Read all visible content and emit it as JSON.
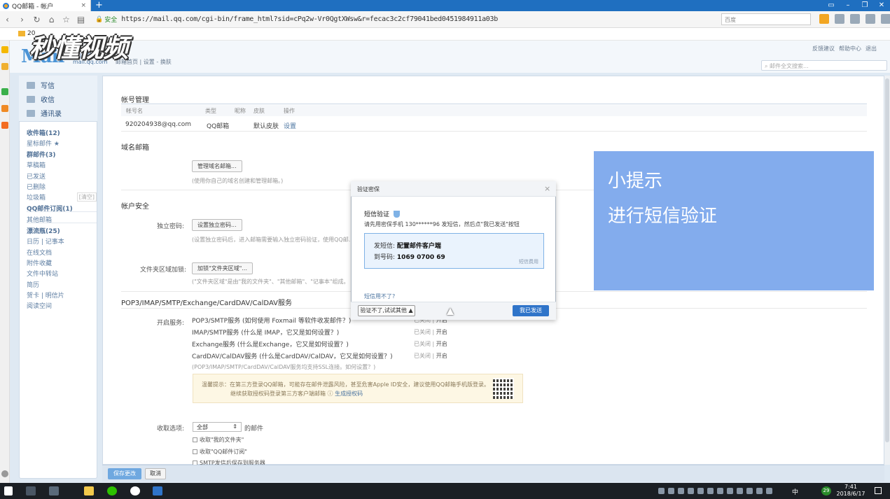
{
  "browser": {
    "tab_title": "QQ邮箱 - 帐户",
    "new_tab": "+",
    "secure_label": "安全",
    "url": "https://mail.qq.com/cgi-bin/frame_html?sid=cPq2w-Vr0QgtXWsw&r=fecac3c2cf79041bed0451984911a03b",
    "search_placeholder": "百度",
    "bookmark_folder": "20"
  },
  "watermark": "秒懂视频",
  "header": {
    "logo": "Mail",
    "logo_sub1": "QQ邮箱",
    "logo_sub2": "mail.qq.com",
    "links": "邮箱首页 | 设置 - 换肤",
    "top_links": [
      "反馈建议",
      "帮助中心",
      "退出"
    ],
    "mail_search_placeholder": "邮件全文搜索..."
  },
  "nav": {
    "write": "写信",
    "inbox": "收信",
    "contacts": "通讯录",
    "folders": [
      {
        "label": "收件箱(12)",
        "bold": true
      },
      {
        "label": "星标邮件 ★"
      },
      {
        "label": "群邮件(3)",
        "bold": true
      },
      {
        "label": "草稿箱"
      },
      {
        "label": "已发送"
      },
      {
        "label": "已删除"
      },
      {
        "label": "垃圾箱",
        "extra": "[清空]"
      },
      {
        "label": "QQ邮件订阅(1)",
        "bold": true,
        "sep": true
      },
      {
        "label": "其他邮箱",
        "sep": true
      },
      {
        "label": "漂流瓶(25)",
        "bold": true
      },
      {
        "label": "日历 | 记事本"
      },
      {
        "label": "在线文档"
      },
      {
        "label": "附件收藏"
      },
      {
        "label": "文件中转站"
      },
      {
        "label": "简历"
      },
      {
        "label": "贺卡 | 明信片"
      },
      {
        "label": "阅读空间"
      }
    ]
  },
  "main": {
    "account_title": "帐号管理",
    "table_headers": [
      "帐号名",
      "类型",
      "昵称",
      "皮肤",
      "操作"
    ],
    "account_row": [
      "920204938@qq.com",
      "QQ邮箱",
      "",
      "默认皮肤",
      "设置"
    ],
    "domain_title": "域名邮箱",
    "domain_btn": "管理域名邮箱...",
    "domain_hint": "(使用你自己的域名创建和管理邮箱。)",
    "security_title": "帐户安全",
    "pwd_label": "独立密码:",
    "pwd_btn": "设置独立密码...",
    "pwd_hint": "(设置独立密码后，进入邮箱需要输入独立密码验证，使用QQ邮...",
    "lock_label": "文件夹区域加锁:",
    "lock_btn": "加锁\"文件夹区域\"...",
    "lock_hint": "(\"文件夹区域\"是由\"我的文件夹\"、\"其他邮箱\"、\"记事本\"组成。",
    "pop_title": "POP3/IMAP/SMTP/Exchange/CardDAV/CalDAV服务",
    "service_label": "开启服务:",
    "services": [
      {
        "name": "POP3/SMTP服务",
        "hint": " (如何使用 Foxmail 等软件收发邮件？)",
        "status": "已关闭 |",
        "action": "开启"
      },
      {
        "name": "IMAP/SMTP服务",
        "hint": " (什么是 IMAP，它又是如何设置？)",
        "status": "已关闭 |",
        "action": "开启"
      },
      {
        "name": "Exchange服务",
        "hint": " (什么是Exchange，它又是如何设置？)",
        "status": "已关闭 |",
        "action": "开启"
      },
      {
        "name": "CardDAV/CalDAV服务",
        "hint": " (什么是CardDAV/CalDAV，它又是如何设置？)",
        "status": "已关闭 |",
        "action": "开启"
      }
    ],
    "ssl_hint": "(POP3/IMAP/SMTP/CardDAV/CalDAV服务均支持SSL连接。如何设置？)",
    "tip_line1": "温馨提示：在第三方登录QQ邮箱，可能存在邮件泄露风险，甚至危害Apple ID安全，建议使用QQ邮箱手机版登录。",
    "tip_line2": "继续获取授权码登录第三方客户端邮箱 ⓘ ",
    "tip_link": "生成授权码",
    "receive_label": "收取选项:",
    "receive_value": "全部",
    "receive_suffix": "的邮件",
    "chk1": "收取\"我的文件夹\"",
    "chk2": "收取\"QQ邮件订阅\"",
    "chk3": "SMTP发信后保存到服务器",
    "save": "保存更改",
    "cancel": "取消"
  },
  "modal": {
    "title": "验证密保",
    "close": "×",
    "sms_title": "短信验证",
    "desc": "请先用密保手机 130******96 发短信，然后点\"我已发送\"按钮",
    "send_label": "发短信:",
    "send_value": "配置邮件客户端",
    "to_label": "到号码:",
    "to_value": "1069 0700 69",
    "fee": "短信费用",
    "cannot": "短信用不了?",
    "try_other": "验证不了,试试其他 ▲",
    "sent_btn": "我已发送"
  },
  "overlay": {
    "line1": "小提示",
    "line2": "进行短信验证"
  },
  "taskbar": {
    "time": "7:41",
    "date": "2018/6/17",
    "ime": "中",
    "badge": "29"
  }
}
